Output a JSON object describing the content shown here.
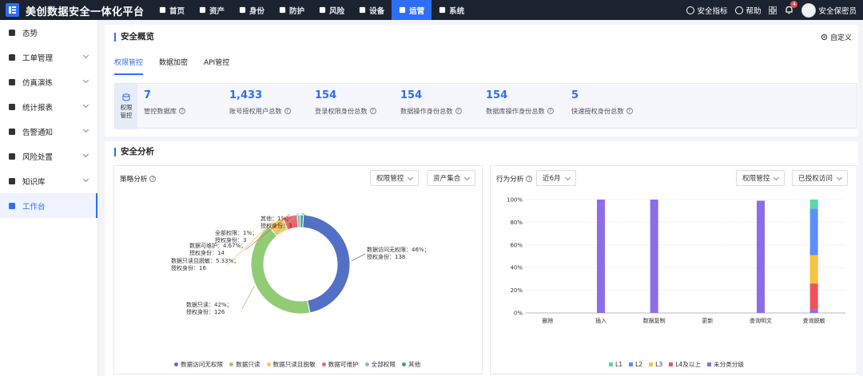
{
  "app": {
    "title": "美创数据安全一体化平台"
  },
  "nav": {
    "items": [
      {
        "label": "首页",
        "icon": "home-icon"
      },
      {
        "label": "资产",
        "icon": "database-icon"
      },
      {
        "label": "身份",
        "icon": "id-card-icon"
      },
      {
        "label": "防护",
        "icon": "shield-icon"
      },
      {
        "label": "风险",
        "icon": "alert-shield-icon"
      },
      {
        "label": "设备",
        "icon": "device-icon"
      },
      {
        "label": "运营",
        "icon": "monitor-icon",
        "active": true
      },
      {
        "label": "系统",
        "icon": "system-icon"
      }
    ]
  },
  "toolbar": {
    "security_index": "安全指标",
    "help": "帮助",
    "notification_count": "4",
    "user_name": "安全保密员"
  },
  "sidebar": {
    "items": [
      {
        "label": "态势",
        "icon": "situation-icon",
        "has_chevron": false
      },
      {
        "label": "工单管理",
        "icon": "clipboard-icon",
        "has_chevron": true
      },
      {
        "label": "仿真演练",
        "icon": "shield-check-icon",
        "has_chevron": true
      },
      {
        "label": "统计报表",
        "icon": "report-icon",
        "has_chevron": true
      },
      {
        "label": "告警通知",
        "icon": "bell-alert-icon",
        "has_chevron": true
      },
      {
        "label": "风险处置",
        "icon": "risk-shield-icon",
        "has_chevron": true
      },
      {
        "label": "知识库",
        "icon": "book-icon",
        "has_chevron": true
      },
      {
        "label": "工作台",
        "icon": "grid-icon",
        "has_chevron": false,
        "active": true
      }
    ]
  },
  "overview": {
    "title": "安全概览",
    "customize": "自定义",
    "tabs": [
      {
        "label": "权限管控",
        "active": true
      },
      {
        "label": "数据加密"
      },
      {
        "label": "API管控"
      }
    ],
    "stats_header": "权限管控",
    "stats": [
      {
        "value": "7",
        "label": "管控数据库"
      },
      {
        "value": "1,433",
        "label": "账号授权用户总数"
      },
      {
        "value": "154",
        "label": "登录权限身份总数"
      },
      {
        "value": "154",
        "label": "数据操作身份总数"
      },
      {
        "value": "154",
        "label": "数据库操作身份总数"
      },
      {
        "value": "5",
        "label": "快速授权身份总数"
      }
    ]
  },
  "analysis": {
    "title": "安全分析",
    "strategy": {
      "title": "策略分析",
      "dropdown1": "权限管控",
      "dropdown2": "资产集合"
    },
    "behavior": {
      "title": "行为分析",
      "period": "近6月",
      "dropdown1": "权限管控",
      "dropdown2": "已授权访问"
    }
  },
  "chart_data": [
    {
      "type": "pie",
      "slices": [
        {
          "name": "数据访问无权限",
          "percent": 46,
          "count": 138,
          "color": "#5470c6",
          "label1": "数据访问无权限：46%；",
          "label2": "授权身份：138"
        },
        {
          "name": "数据只读",
          "percent": 42,
          "count": 126,
          "color": "#91cc75",
          "label1": "数据只读：42%；",
          "label2": "授权身份：126"
        },
        {
          "name": "数据只读且脱敏",
          "percent": 5.33,
          "count": 16,
          "color": "#fac858",
          "label1": "数据只读且脱敏：5.33%；",
          "label2": "授权身份：16"
        },
        {
          "name": "数据可维护",
          "percent": 4.67,
          "count": 14,
          "color": "#ee6666",
          "label1": "数据可维护：4.67%；",
          "label2": "授权身份：14"
        },
        {
          "name": "全部权限",
          "percent": 1,
          "count": 3,
          "color": "#73c0de",
          "label1": "全部权限：1%；",
          "label2": "授权身份：3"
        },
        {
          "name": "其他",
          "percent": 1,
          "count": 3,
          "color": "#3ba272",
          "label1": "其他：1%；",
          "label2": "授权身份：3"
        }
      ]
    },
    {
      "type": "bar",
      "stacked": true,
      "categories": [
        "删除",
        "插入",
        "数据复制",
        "更新",
        "查询明文",
        "查询脱敏"
      ],
      "yticks": [
        "0%",
        "20%",
        "40%",
        "60%",
        "80%",
        "100%"
      ],
      "ylim": [
        0,
        100
      ],
      "series": [
        {
          "name": "L1",
          "color": "#5ad8a6",
          "values": [
            0,
            0,
            0,
            0,
            0,
            8
          ]
        },
        {
          "name": "L2",
          "color": "#5b8ff9",
          "values": [
            0,
            0,
            0,
            0,
            0,
            41
          ]
        },
        {
          "name": "L3",
          "color": "#f6c342",
          "values": [
            0,
            0,
            0,
            0,
            0,
            25
          ]
        },
        {
          "name": "L4及以上",
          "color": "#f0525d",
          "values": [
            0,
            0,
            0,
            0,
            0,
            23
          ]
        },
        {
          "name": "未分类分级",
          "color": "#8d6cea",
          "values": [
            0,
            100,
            100,
            0,
            99,
            3
          ]
        }
      ]
    }
  ]
}
